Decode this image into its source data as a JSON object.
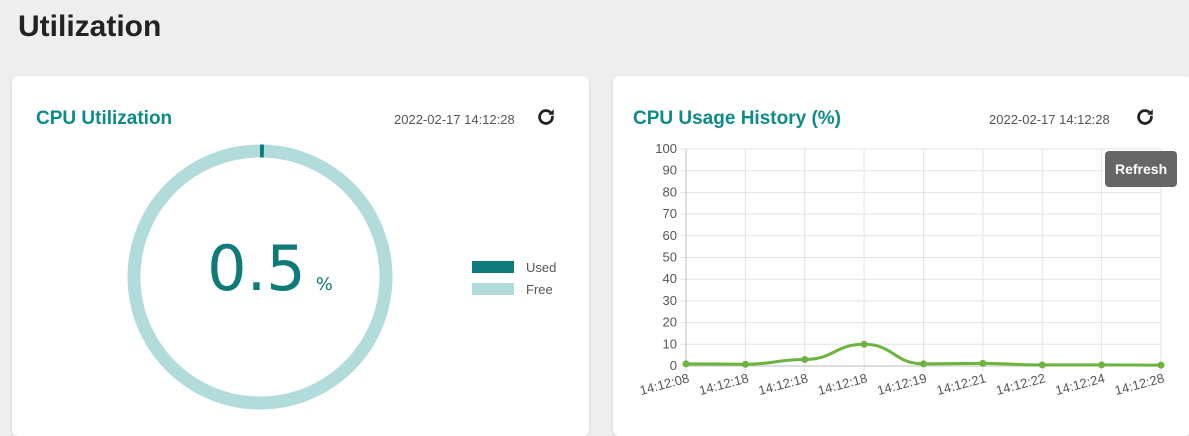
{
  "page": {
    "title": "Utilization"
  },
  "cpu_utilization": {
    "title": "CPU Utilization",
    "timestamp": "2022-02-17 14:12:28",
    "value": "0.5",
    "unit": "%",
    "used_fraction": 0.005,
    "legend": {
      "used": "Used",
      "free": "Free"
    },
    "colors": {
      "used": "#0e7a7a",
      "free": "#b2dcdb"
    },
    "refresh_icon": "refresh-icon"
  },
  "cpu_history": {
    "title": "CPU Usage History (%)",
    "timestamp": "2022-02-17 14:12:28",
    "tooltip": "Refresh",
    "refresh_icon": "refresh-icon"
  },
  "chart_data": {
    "type": "line",
    "title": "CPU Usage History (%)",
    "x": [
      "14:12:08",
      "14:12:18",
      "14:12:18",
      "14:12:18",
      "14:12:19",
      "14:12:21",
      "14:12:22",
      "14:12:24",
      "14:12:28"
    ],
    "series": [
      {
        "values": [
          1.0,
          0.8,
          3.0,
          10.0,
          1.0,
          1.2,
          0.5,
          0.5,
          0.4
        ],
        "color": "#6db33f"
      }
    ],
    "yticks": [
      0,
      10,
      20,
      30,
      40,
      50,
      60,
      70,
      80,
      90,
      100
    ],
    "ylim": [
      0,
      100
    ],
    "grid": true,
    "xlabel": "",
    "ylabel": ""
  }
}
